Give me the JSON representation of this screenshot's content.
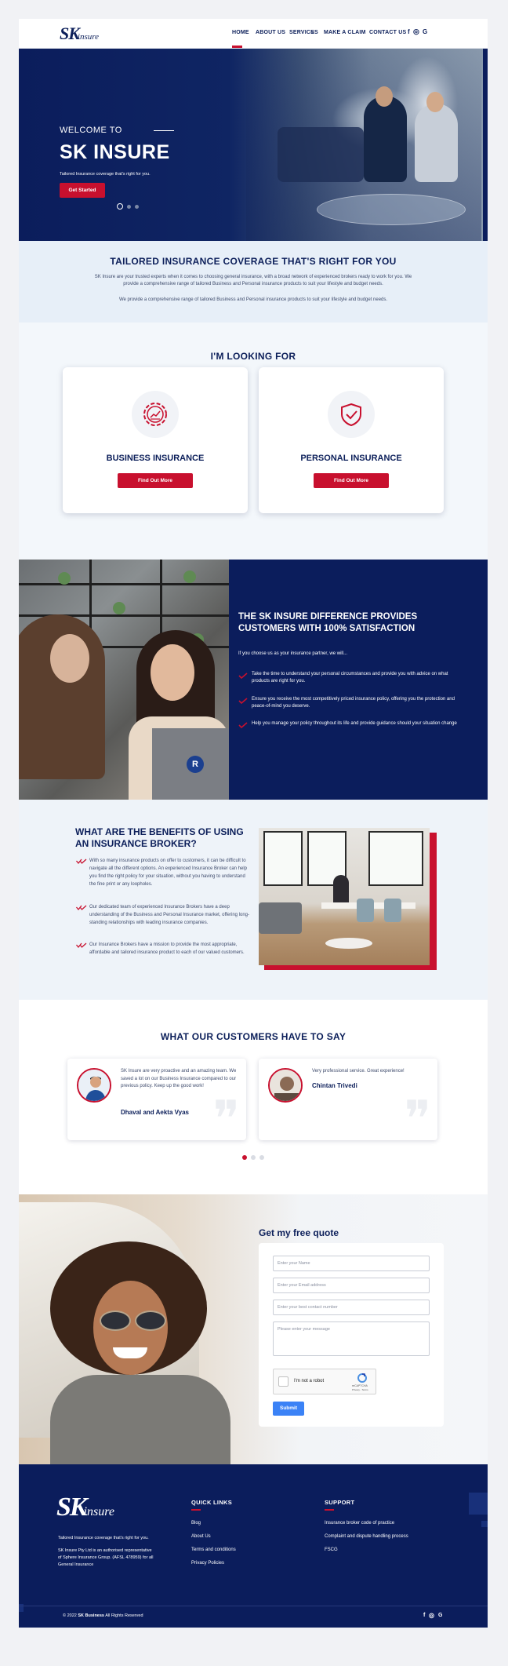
{
  "header": {
    "logo_main": "SK",
    "logo_sub": "insure",
    "nav": [
      "HOME",
      "ABOUT US",
      "SERVICES",
      "MAKE A CLAIM",
      "CONTACT US"
    ],
    "services_caret": "▾",
    "social": [
      "f",
      "◎",
      "G"
    ]
  },
  "hero": {
    "welcome": "WELCOME TO",
    "title": "SK INSURE",
    "subtitle": "Tailored Insurance coverage that's right for you.",
    "cta": "Get Started"
  },
  "intro": {
    "title": "TAILORED INSURANCE COVERAGE THAT'S RIGHT FOR YOU",
    "p1a": "SK Insure are your trusted experts when it comes to choosing general insurance, with a broad network of experienced brokers ready to work for you. We",
    "p1b": "provide a comprehensive range of tailored Business and Personal insurance products to suit your lifestyle and budget needs.",
    "p2": "We provide a comprehensive range of tailored Business and Personal insurance products to suit your lifestyle and budget needs."
  },
  "looking": {
    "title": "I'M LOOKING FOR",
    "cards": [
      {
        "title": "BUSINESS INSURANCE",
        "button": "Find Out More",
        "icon": "gear-chart-icon"
      },
      {
        "title": "PERSONAL INSURANCE",
        "button": "Find Out More",
        "icon": "shield-check-icon"
      }
    ]
  },
  "difference": {
    "title": "THE SK INSURE DIFFERENCE PROVIDES CUSTOMERS WITH 100% SATISFACTION",
    "lead": "If you choose us as your insurance partner, we will...",
    "items": [
      "Take the time to understand your personal circumstances and provide you with advice on what products are right for you.",
      "Ensure you receive the most competitively priced insurance policy, offering you the protection and peace-of-mind you deserve.",
      "Help you manage your policy throughout its life and provide guidance should your situation change"
    ]
  },
  "benefits": {
    "title": "WHAT ARE THE BENEFITS OF USING AN INSURANCE BROKER?",
    "items": [
      "With so many insurance products on offer to customers, it can be difficult to navigate all the different options. An experienced Insurance Broker can help you find the right policy for your situation, without you having to understand the fine print or any loopholes.",
      "Our dedicated team of experienced Insurance Brokers have a deep understanding of the Business and Personal Insurance market, offering long-standing relationships with leading insurance companies.",
      "Our Insurance Brokers have a mission to provide the most appropriate, affordable and tailored insurance product to each of our valued customers."
    ]
  },
  "testimonials": {
    "title": "WHAT OUR CUSTOMERS HAVE TO SAY",
    "items": [
      {
        "text": "SK Insure are very proactive and an amazing team. We saved a lot on our Business Insurance compared to our previous policy. Keep up the good work!",
        "name": "Dhaval and Aekta Vyas"
      },
      {
        "text": "Very professional service. Great experience!",
        "name": "Chintan Trivedi"
      }
    ]
  },
  "quote": {
    "title": "Get my free quote",
    "name_ph": "Enter your Name",
    "email_ph": "Enter your Email address",
    "phone_ph": "Enter your best contact number",
    "message_ph": "Please enter your message",
    "captcha_label": "I'm not a robot",
    "captcha_brand": "reCAPTCHA",
    "captcha_terms": "Privacy - Terms",
    "submit": "Submit"
  },
  "footer": {
    "logo_main": "SK",
    "logo_sub": "insure",
    "tagline": "Tailored Insurance coverage that's right for you.",
    "legal1": "SK Insure Pty Ltd is an authorised representative",
    "legal2": "of Sphere Insurance Group. (AFSL 478959) for all",
    "legal3": "General Insurance",
    "quick_title": "QUICK LINKS",
    "quick_links": [
      "Blog",
      "About Us",
      "Terms and conditions",
      "Privacy Policies"
    ],
    "support_title": "SUPPORT",
    "support_links": [
      "Insurance broker code of practice",
      "Complaint and dispute handling process",
      "FSCG"
    ],
    "copyright_year": "© 2022",
    "copyright_brand": "SK Business",
    "copyright_rest": "All Rights Reserved",
    "social": [
      "f",
      "◎",
      "G"
    ]
  },
  "colors": {
    "navy": "#0b1d5c",
    "red": "#c8102e",
    "light": "#e7eff8",
    "submit_blue": "#3b82f6"
  }
}
